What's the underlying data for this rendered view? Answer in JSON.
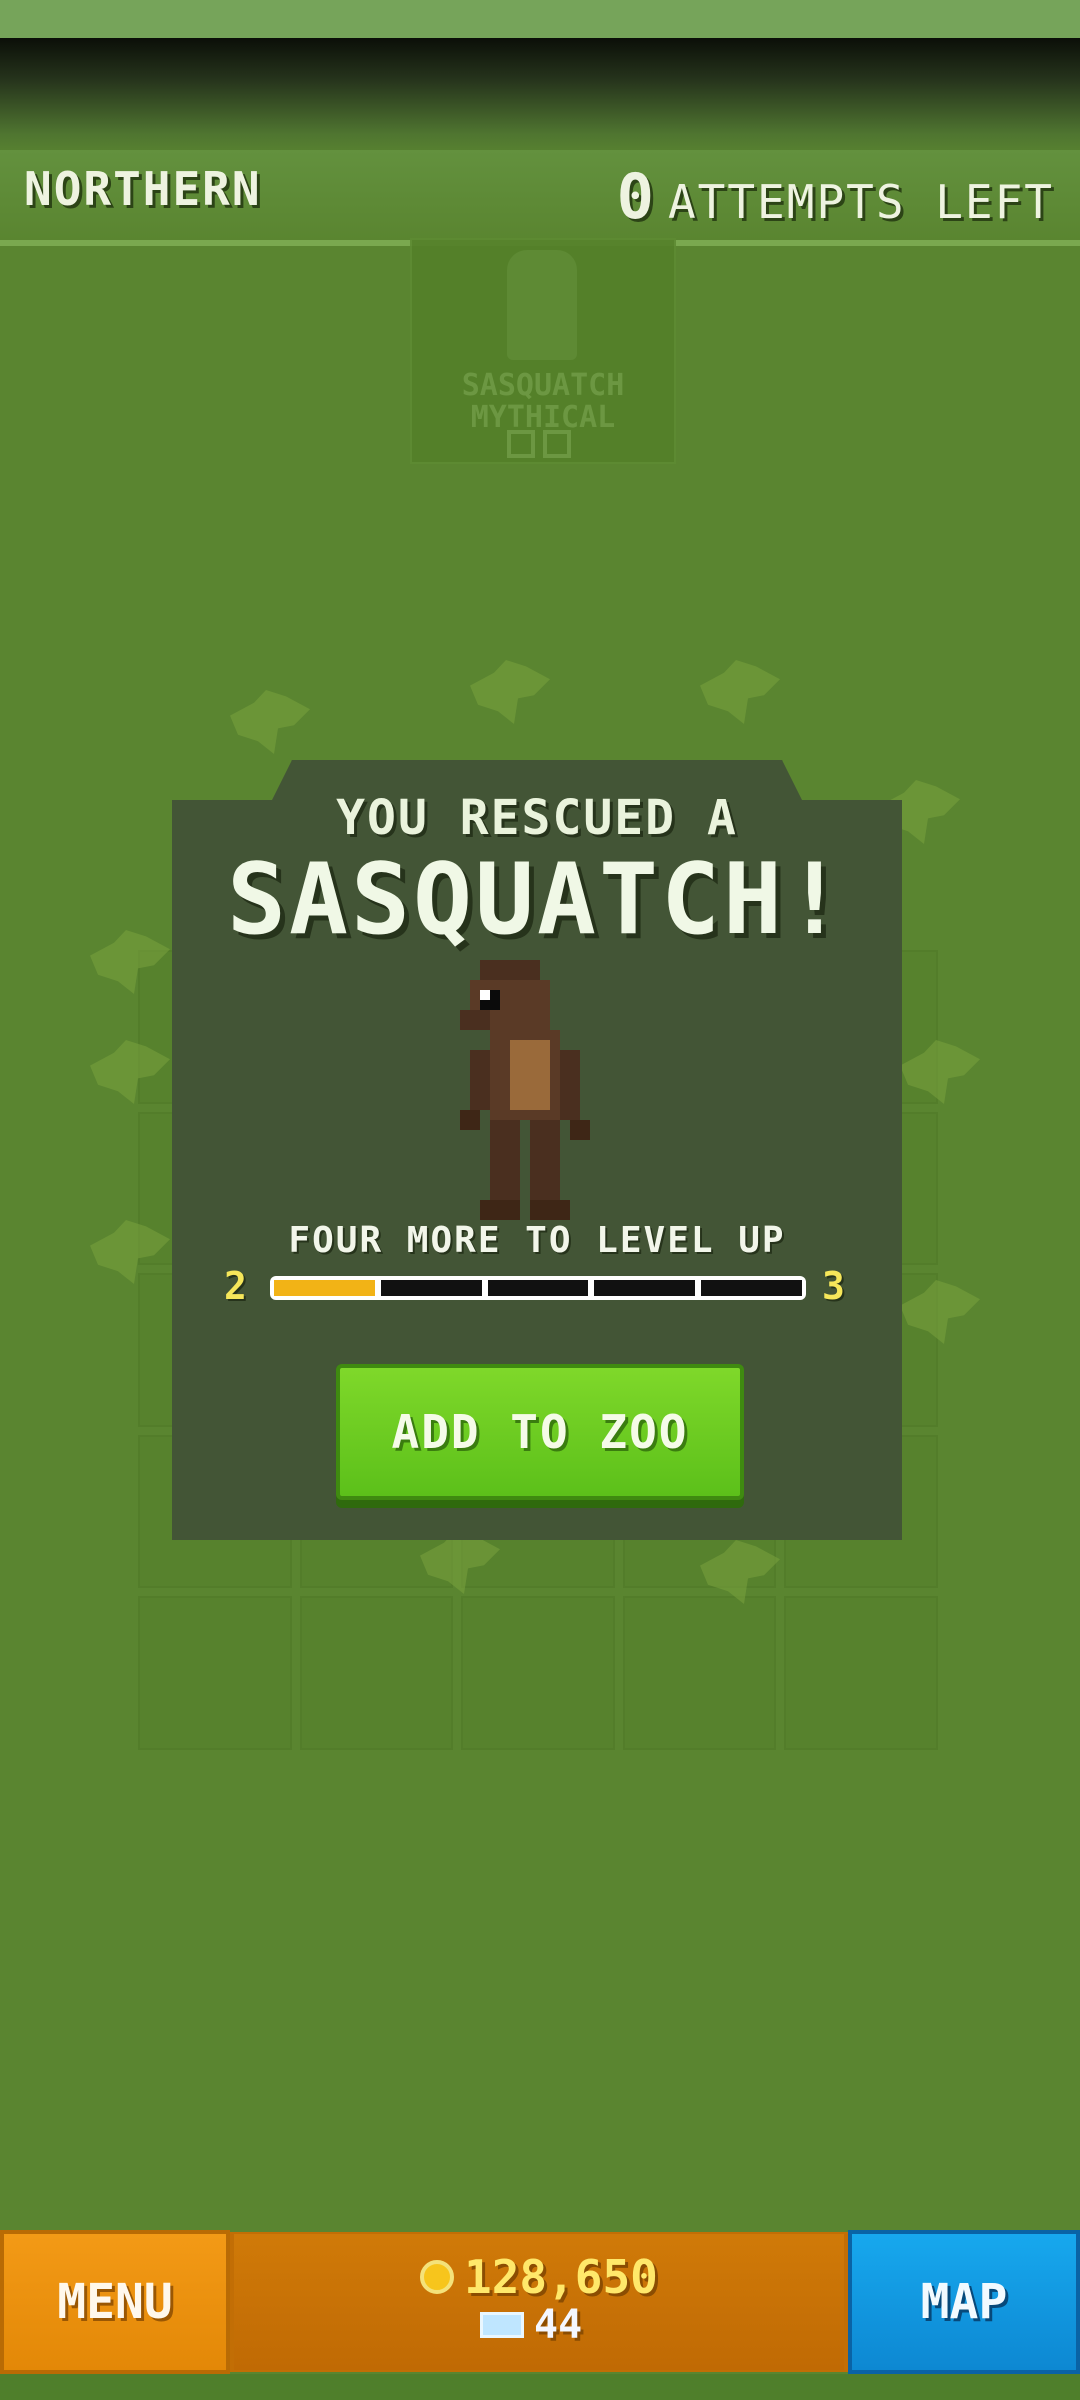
{
  "hud": {
    "region": "NORTHERN",
    "attempts_count": "0",
    "attempts_label": "ATTEMPTS LEFT"
  },
  "background_card": {
    "name": "SASQUATCH",
    "rarity": "MYTHICAL"
  },
  "dialog": {
    "title_small": "YOU RESCUED A",
    "title_big": "SASQUATCH!",
    "level_text": "FOUR MORE TO LEVEL UP",
    "level_from": "2",
    "level_to": "3",
    "progress_segments_total": 5,
    "progress_segments_filled": 1,
    "add_button": "ADD TO ZOO"
  },
  "bottom_bar": {
    "menu_label": "MENU",
    "map_label": "MAP",
    "coins": "128,650",
    "gems": "44"
  },
  "icons": [
    "coin-icon",
    "gem-icon",
    "sasquatch-sprite"
  ],
  "colors": {
    "background": "#5a8530",
    "dialog": "#435536",
    "add_button": "#6cc81f",
    "progress_fill": "#f2b316",
    "menu_button": "#f39a16",
    "map_button": "#17a8ee"
  }
}
